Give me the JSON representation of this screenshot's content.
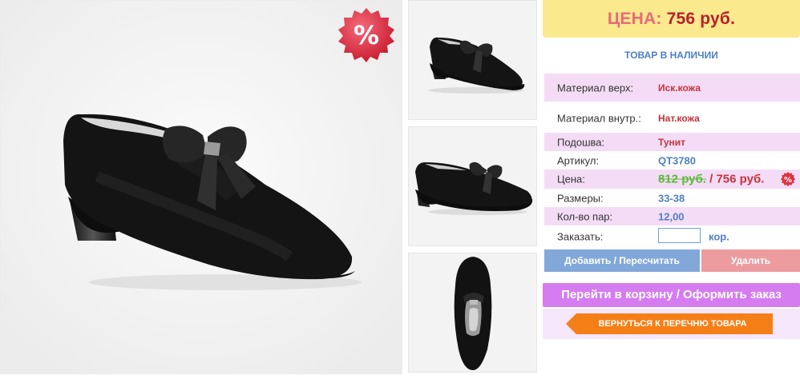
{
  "price_banner": {
    "label": "ЦЕНА:",
    "value": "756 руб."
  },
  "stock_status": "ТОВАР В НАЛИЧИИ",
  "attributes": [
    {
      "key": "Материал верх:",
      "value": "Иск.кожа"
    },
    {
      "key": "Материал внутр.:",
      "value": "Нат.кожа"
    },
    {
      "key": "Подошва:",
      "value": "Тунит"
    },
    {
      "key": "Артикул:",
      "value": "QT3780"
    },
    {
      "key": "Цена:",
      "old_value": "812 руб.",
      "separator": "/",
      "value": "756 руб."
    },
    {
      "key": "Размеры:",
      "value": "33-38"
    },
    {
      "key": "Кол-во пар:",
      "value": "12,00"
    }
  ],
  "order": {
    "label": "Заказать:",
    "quantity_value": "",
    "unit": "кор."
  },
  "buttons": {
    "add": "Добавить / Пересчитать",
    "delete": "Удалить",
    "cart": "Перейти в корзину / Оформить заказ",
    "back": "ВЕРНУТЬСЯ К ПЕРЕЧНЮ ТОВАРА"
  },
  "badge_symbol": "%",
  "icons": [
    "sale-percent-icon",
    "back-arrow-icon"
  ],
  "colors": {
    "price_banner_bg": "#fbe98e",
    "price_red": "#b8202b",
    "link_blue": "#4f7fc4",
    "row_pink": "#f4dcf6",
    "old_price_green": "#5dba3a",
    "add_button": "#82a8da",
    "delete_button": "#ec9c9f",
    "cart_button": "#d57cf0",
    "back_button": "#f57f17"
  }
}
